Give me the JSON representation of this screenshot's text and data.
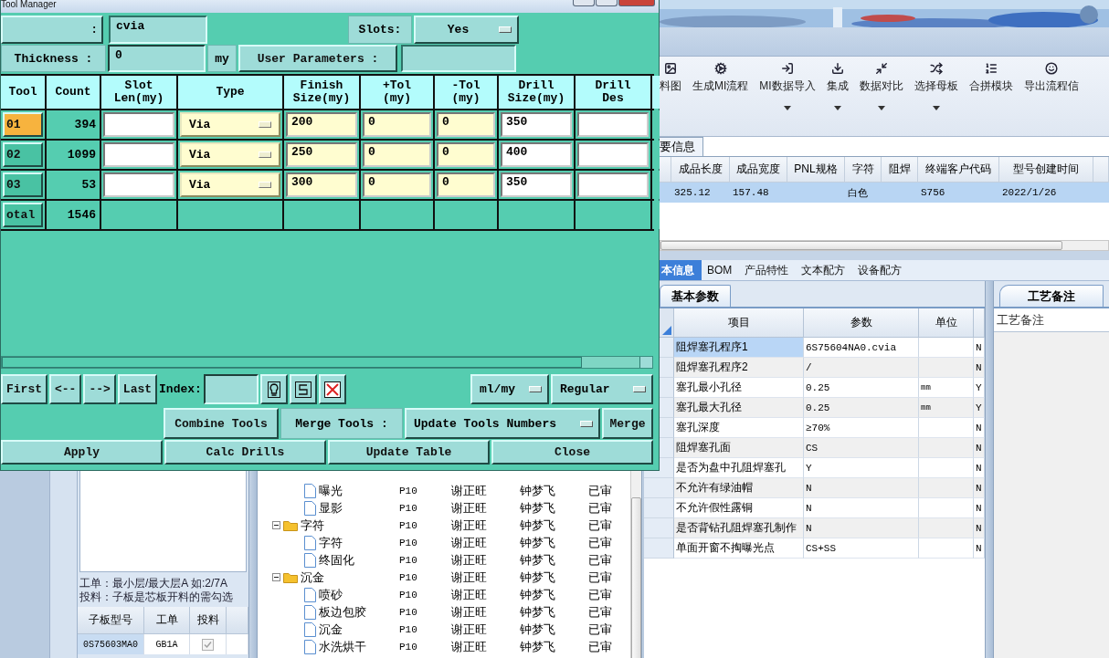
{
  "tool_manager": {
    "title": "Tool Manager",
    "name_button": ":",
    "name_value": "cvia",
    "slots_label": "Slots:",
    "slots_value": "Yes",
    "thickness_label": "Thickness :",
    "thickness_value": "0",
    "thickness_unit": "my",
    "user_params_label": "User Parameters :",
    "columns": [
      "Tool",
      "Count",
      "Slot\nLen(my)",
      "Type",
      "Finish\nSize(my)",
      "+Tol\n(my)",
      "-Tol\n(my)",
      "Drill\nSize(my)",
      "Drill\nDes"
    ],
    "rows": [
      {
        "tool": "01",
        "selected": true,
        "count": "394",
        "type": "Via",
        "finish": "200",
        "plus_tol": "0",
        "minus_tol": "0",
        "drill_size": "350"
      },
      {
        "tool": "02",
        "selected": false,
        "count": "1099",
        "type": "Via",
        "finish": "250",
        "plus_tol": "0",
        "minus_tol": "0",
        "drill_size": "400"
      },
      {
        "tool": "03",
        "selected": false,
        "count": "53",
        "type": "Via",
        "finish": "300",
        "plus_tol": "0",
        "minus_tol": "0",
        "drill_size": "350"
      }
    ],
    "total": {
      "label": "otal",
      "count": "1546"
    },
    "nav_buttons": [
      "First",
      "<--",
      "-->",
      "Last"
    ],
    "index_label": "Index:",
    "units": "ml/my",
    "mode": "Regular",
    "combine": "Combine Tools",
    "merge_label": "Merge Tools :",
    "merge_option": "Update Tools Numbers",
    "merge": "Merge",
    "actions": [
      "Apply",
      "Calc Drills",
      "Update Table",
      "Close"
    ]
  },
  "ribbon": [
    {
      "label": "料图",
      "dropdown": false
    },
    {
      "label": "生成MI流程",
      "dropdown": false
    },
    {
      "label": "MI数据导入",
      "dropdown": true
    },
    {
      "label": "集成",
      "dropdown": true
    },
    {
      "label": "数据对比",
      "dropdown": true
    },
    {
      "label": "选择母板",
      "dropdown": true
    },
    {
      "label": "合拼模块",
      "dropdown": false
    },
    {
      "label": "导出流程信",
      "dropdown": false
    }
  ],
  "summary": {
    "tab": "要信息",
    "columns": [
      "成品长度",
      "成品宽度",
      "PNL规格",
      "字符",
      "阻焊",
      "终端客户代码",
      "型号创建时间"
    ],
    "rows": [
      {
        "selected": true,
        "cells": [
          "325.12",
          "157.48",
          null,
          "白色",
          null,
          "S756",
          "2022/1/26"
        ]
      }
    ]
  },
  "left_panel": {
    "hints": [
      "工单：最小层/最大层A 如:2/7A",
      "投料：子板是芯板开料的需勾选"
    ],
    "columns": [
      "子板型号",
      "工单",
      "投料"
    ],
    "rows": [
      {
        "cells": [
          "0S75603MA0",
          "GB1A"
        ],
        "checked": true,
        "disabled": true
      }
    ]
  },
  "tree": [
    {
      "children": [
        {
          "label": "曝光",
          "kind": "file",
          "cells": [
            "P10",
            "谢正旺",
            "钟梦飞",
            "已审"
          ]
        },
        {
          "label": "显影",
          "kind": "file",
          "cells": [
            "P10",
            "谢正旺",
            "钟梦飞",
            "已审"
          ]
        }
      ]
    },
    {
      "label": "字符",
      "kind": "folder",
      "expanded": true,
      "cells": [
        "P10",
        "谢正旺",
        "钟梦飞",
        "已审"
      ],
      "children": [
        {
          "label": "字符",
          "kind": "file",
          "cells": [
            "P10",
            "谢正旺",
            "钟梦飞",
            "已审"
          ]
        },
        {
          "label": "终固化",
          "kind": "file",
          "cells": [
            "P10",
            "谢正旺",
            "钟梦飞",
            "已审"
          ]
        }
      ]
    },
    {
      "label": "沉金",
      "kind": "folder",
      "expanded": true,
      "cells": [
        "P10",
        "谢正旺",
        "钟梦飞",
        "已审"
      ],
      "children": [
        {
          "label": "喷砂",
          "kind": "file",
          "cells": [
            "P10",
            "谢正旺",
            "钟梦飞",
            "已审"
          ]
        },
        {
          "label": "板边包胶",
          "kind": "file",
          "cells": [
            "P10",
            "谢正旺",
            "钟梦飞",
            "已审"
          ]
        },
        {
          "label": "沉金",
          "kind": "file",
          "cells": [
            "P10",
            "谢正旺",
            "钟梦飞",
            "已审"
          ]
        },
        {
          "label": "水洗烘干",
          "kind": "file",
          "cells": [
            "P10",
            "谢正旺",
            "钟梦飞",
            "已审"
          ]
        }
      ]
    }
  ],
  "details": {
    "tabs": [
      {
        "label": "本信息",
        "selected": true
      },
      {
        "label": "BOM",
        "selected": false
      },
      {
        "label": "产品特性",
        "selected": false
      },
      {
        "label": "文本配方",
        "selected": false
      },
      {
        "label": "设备配方",
        "selected": false
      }
    ],
    "subtab": "基本参数",
    "columns": [
      "项目",
      "参数",
      "单位"
    ],
    "rows": [
      {
        "item": "阻焊塞孔程序1",
        "value": "6S75604NA0.cvia",
        "flag": "N",
        "selected": true
      },
      {
        "item": "阻焊塞孔程序2",
        "value": "/",
        "flag": "N",
        "selected": false
      },
      {
        "item": "塞孔最小孔径",
        "value": "0.25",
        "unit": "mm",
        "flag": "Y",
        "selected": false
      },
      {
        "item": "塞孔最大孔径",
        "value": "0.25",
        "unit": "mm",
        "flag": "Y",
        "selected": false
      },
      {
        "item": "塞孔深度",
        "value": "≥70%",
        "flag": "N",
        "selected": false
      },
      {
        "item": "阻焊塞孔面",
        "value": "CS",
        "flag": "N",
        "selected": false
      },
      {
        "item": "是否为盘中孔阻焊塞孔",
        "value": "Y",
        "flag": "N",
        "selected": false
      },
      {
        "item": "不允许有绿油帽",
        "value": "N",
        "flag": "N",
        "selected": false
      },
      {
        "item": "不允许假性露铜",
        "value": "N",
        "flag": "N",
        "selected": false
      },
      {
        "item": "是否背钻孔阻焊塞孔制作",
        "value": "N",
        "flag": "N",
        "selected": false
      },
      {
        "item": "单面开窗不掏曝光点",
        "value": "CS+SS",
        "flag": "N",
        "selected": false
      }
    ],
    "notes_tab": "工艺备注",
    "notes_label": "工艺备注"
  }
}
